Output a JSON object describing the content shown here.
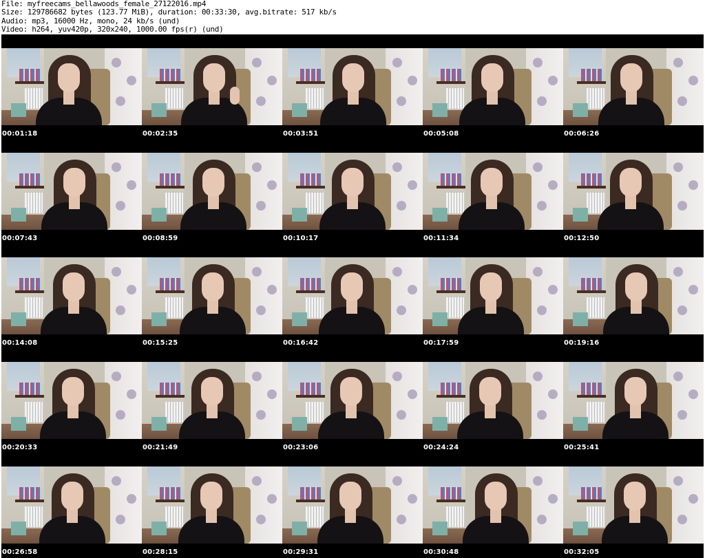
{
  "header": {
    "file": "File: myfreecams_bellawoods_female_27122016.mp4",
    "size": "Size: 129786682 bytes (123.77 MiB), duration: 00:33:30, avg.bitrate: 517 kb/s",
    "audio": "Audio: mp3, 16000 Hz, mono, 24 kb/s (und)",
    "video": "Video: h264, yuv420p, 320x240, 1000.00 fps(r) (und)"
  },
  "thumbnails": [
    {
      "time": "00:01:18",
      "variant": "center"
    },
    {
      "time": "00:02:35",
      "variant": "hand"
    },
    {
      "time": "00:03:51",
      "variant": "center"
    },
    {
      "time": "00:05:08",
      "variant": "center"
    },
    {
      "time": "00:06:26",
      "variant": "center"
    },
    {
      "time": "00:07:43",
      "variant": "center"
    },
    {
      "time": "00:08:59",
      "variant": "center"
    },
    {
      "time": "00:10:17",
      "variant": "center"
    },
    {
      "time": "00:11:34",
      "variant": "center"
    },
    {
      "time": "00:12:50",
      "variant": "center"
    },
    {
      "time": "00:14:08",
      "variant": "center"
    },
    {
      "time": "00:15:25",
      "variant": "center"
    },
    {
      "time": "00:16:42",
      "variant": "center"
    },
    {
      "time": "00:17:59",
      "variant": "center"
    },
    {
      "time": "00:19:16",
      "variant": "center"
    },
    {
      "time": "00:20:33",
      "variant": "center"
    },
    {
      "time": "00:21:49",
      "variant": "center"
    },
    {
      "time": "00:23:06",
      "variant": "center"
    },
    {
      "time": "00:24:24",
      "variant": "center"
    },
    {
      "time": "00:25:41",
      "variant": "center"
    },
    {
      "time": "00:26:58",
      "variant": "center"
    },
    {
      "time": "00:28:15",
      "variant": "center"
    },
    {
      "time": "00:29:31",
      "variant": "center"
    },
    {
      "time": "00:30:48",
      "variant": "center"
    },
    {
      "time": "00:32:05",
      "variant": "center"
    }
  ],
  "colors": {
    "sheet_background": "#000000",
    "page_background": "#ffffff",
    "timestamp_text": "#ffffff"
  }
}
